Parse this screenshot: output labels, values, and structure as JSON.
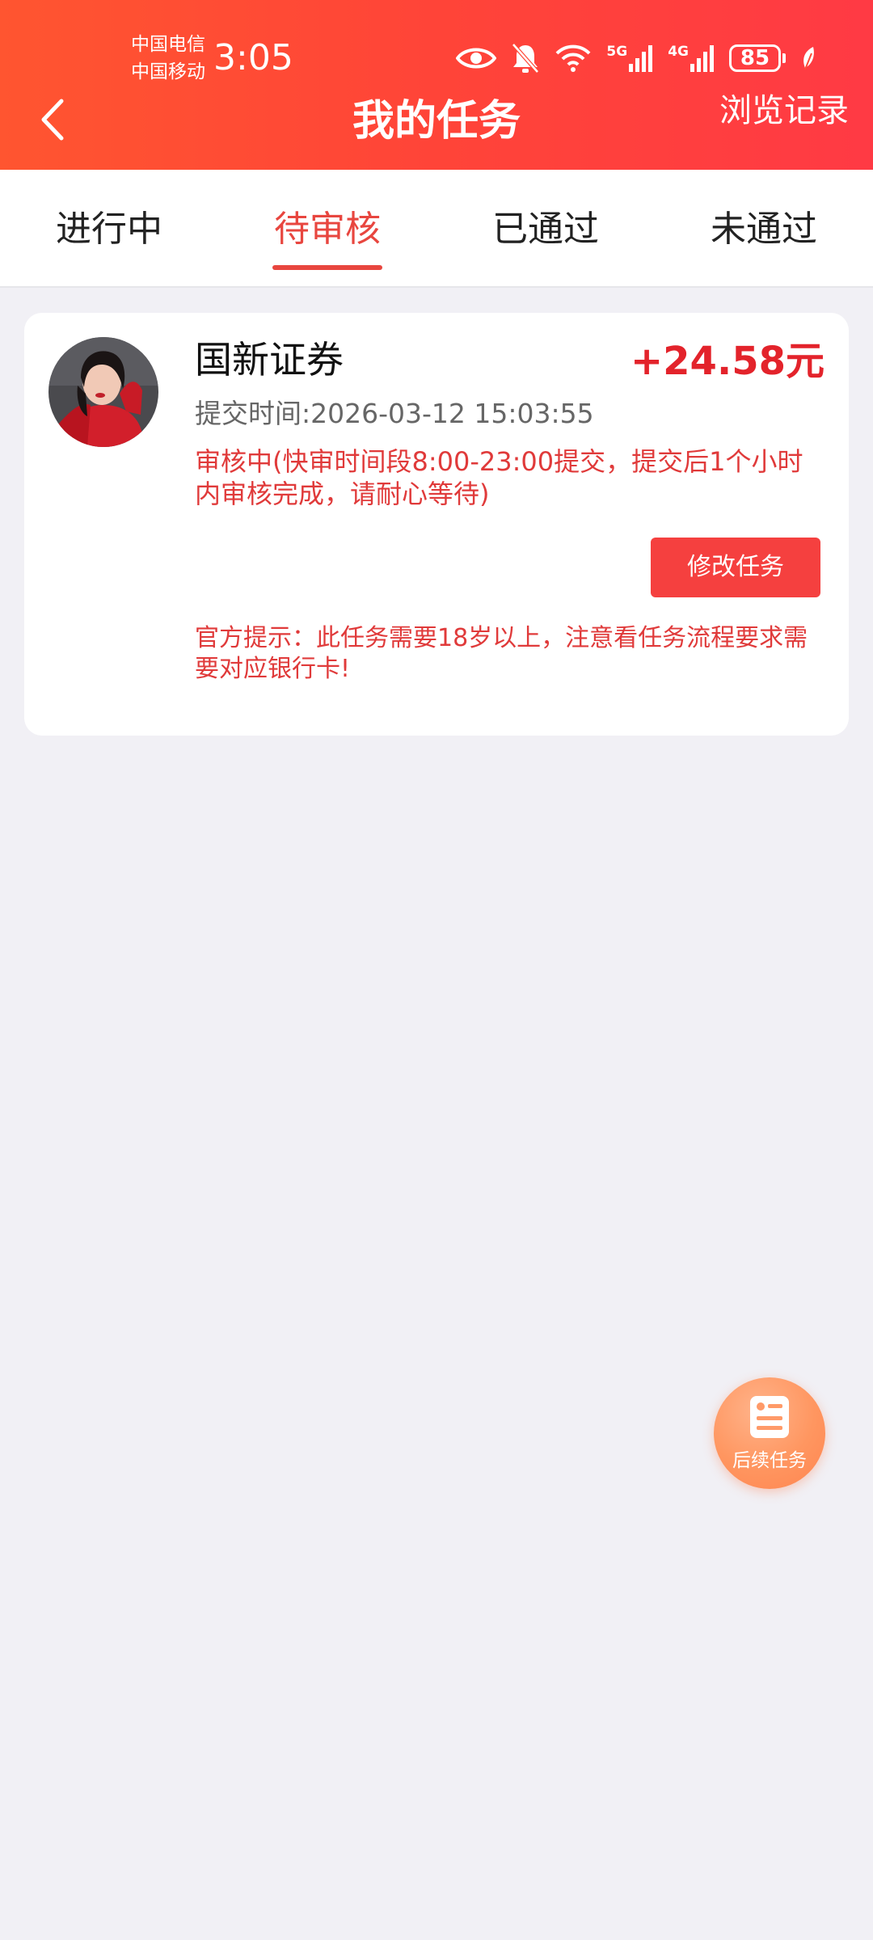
{
  "status_bar": {
    "carrier_1": "中国电信",
    "carrier_2": "中国移动",
    "time": "3:05",
    "battery": "85",
    "network_1": "5G",
    "network_2": "4G"
  },
  "nav": {
    "title": "我的任务",
    "history_label": "浏览记录"
  },
  "tabs": [
    {
      "label": "进行中",
      "active": false
    },
    {
      "label": "待审核",
      "active": true
    },
    {
      "label": "已通过",
      "active": false
    },
    {
      "label": "未通过",
      "active": false
    }
  ],
  "task": {
    "name": "国新证券",
    "reward": "+24.58元",
    "submit_time": "提交时间:2026-03-12 15:03:55",
    "review_status": "审核中(快审时间段8:00-23:00提交，提交后1个小时内审核完成，请耐心等待)",
    "modify_button": "修改任务",
    "official_tip": "官方提示：此任务需要18岁以上，注意看任务流程要求需要对应银行卡!"
  },
  "fab": {
    "label": "后续任务",
    "icon": "document-list-icon"
  },
  "colors": {
    "header_start": "#ff5530",
    "header_end": "#ff3a44",
    "accent": "#e8463f",
    "reward": "#e3232b",
    "page_bg": "#f1f0f5"
  }
}
